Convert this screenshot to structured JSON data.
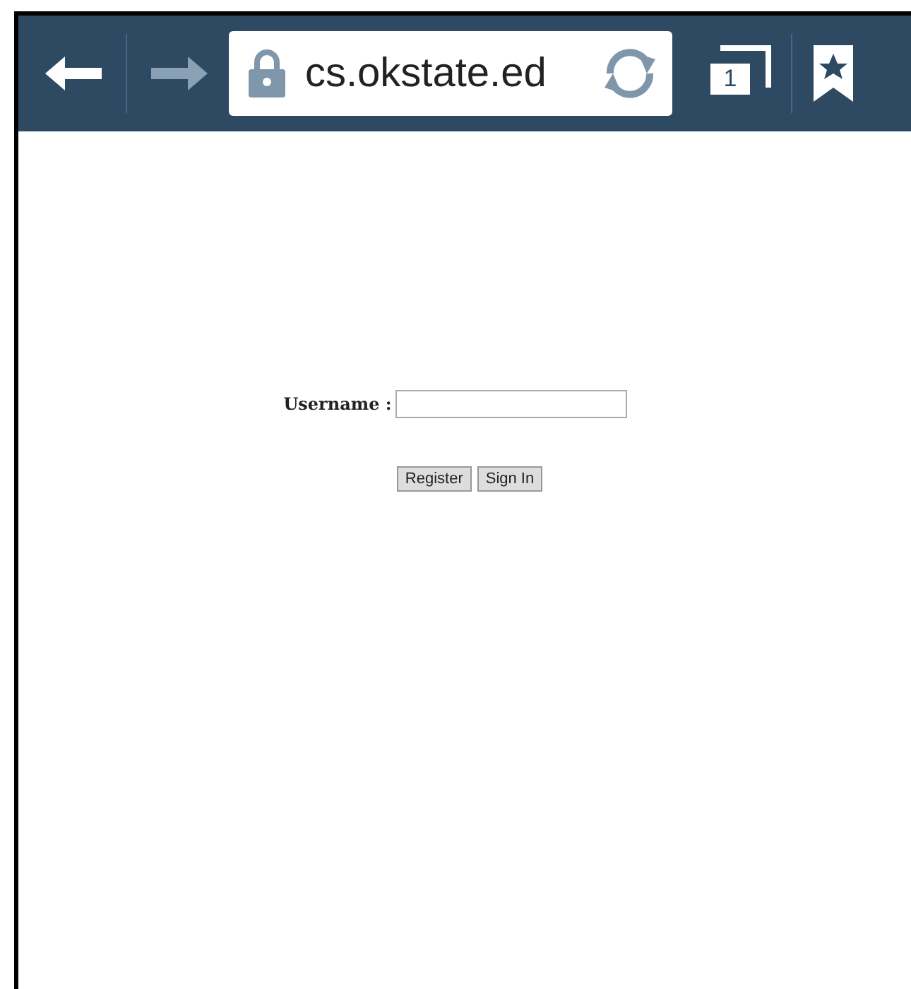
{
  "browser": {
    "url": "cs.okstate.ed",
    "tab_count": "1",
    "back_enabled": true,
    "forward_enabled": false
  },
  "form": {
    "label": "Username :",
    "buttons": [
      "Register",
      "Sign In"
    ]
  }
}
